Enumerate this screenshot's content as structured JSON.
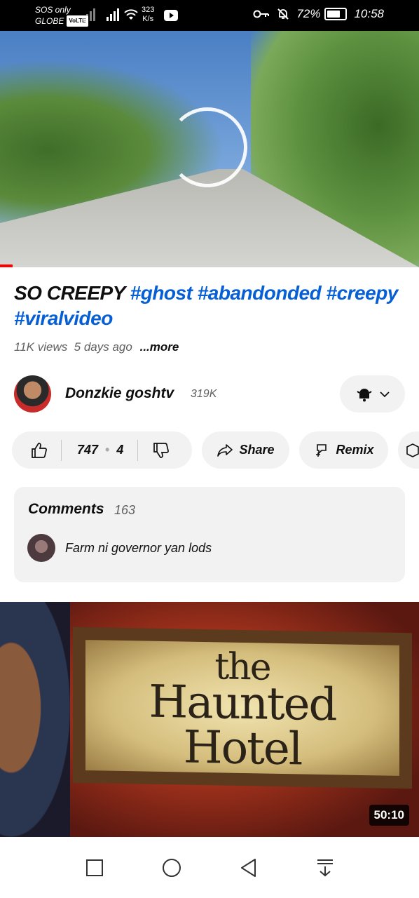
{
  "status_bar": {
    "carrier_line1": "SOS only",
    "carrier_line2": "GLOBE",
    "volte": "VoLTE",
    "speed_value": "323",
    "speed_unit": "K/s",
    "battery": "72%",
    "battery_level": 0.72,
    "time": "10:58"
  },
  "video": {
    "progress_percent": 3
  },
  "title": {
    "plain": "SO CREEPY ",
    "hashtags": [
      "#ghost",
      "#abandonded",
      "#creepy",
      "#viralvideo"
    ]
  },
  "meta": {
    "views": "11K views",
    "age": "5 days ago",
    "more": "...more"
  },
  "channel": {
    "name": "Donzkie goshtv",
    "subscribers": "319K"
  },
  "actions": {
    "likes": "747",
    "dislikes": "4",
    "share": "Share",
    "remix": "Remix"
  },
  "comments": {
    "heading": "Comments",
    "count": "163",
    "top_comment": "Farm ni governor yan lods"
  },
  "next_video": {
    "sign_line1": "the",
    "sign_line2": "Haunted Hotel",
    "duration": "50:10"
  },
  "icons": {
    "like": "thumbs-up-icon",
    "dislike": "thumbs-down-icon",
    "share": "share-arrow-icon",
    "remix": "remix-icon",
    "bell": "bell-icon",
    "nav_recents": "square-icon",
    "nav_home": "circle-icon",
    "nav_back": "triangle-back-icon",
    "nav_down": "collapse-icon"
  }
}
